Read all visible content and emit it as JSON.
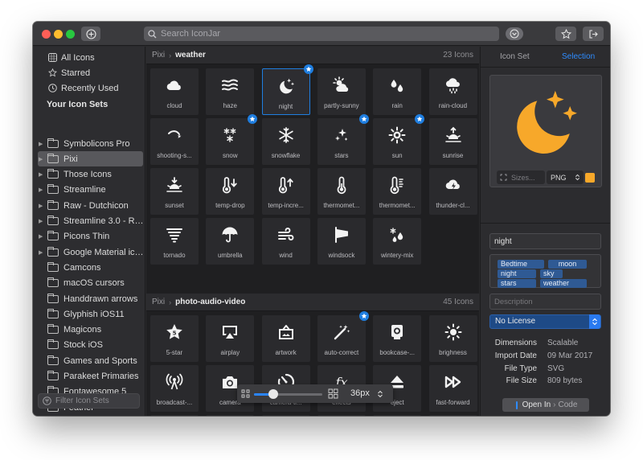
{
  "search": {
    "placeholder": "Search IconJar"
  },
  "sidebar": {
    "library": [
      {
        "label": "All Icons",
        "icon": "grid-icon"
      },
      {
        "label": "Starred",
        "icon": "star-icon"
      },
      {
        "label": "Recently Used",
        "icon": "clock-icon"
      }
    ],
    "sets_heading": "Your Icon Sets",
    "sets": [
      {
        "label": "Symbolicons Pro",
        "expandable": true,
        "selected": false
      },
      {
        "label": "Pixi",
        "expandable": true,
        "selected": true
      },
      {
        "label": "Those Icons",
        "expandable": true,
        "selected": false
      },
      {
        "label": "Streamline",
        "expandable": true,
        "selected": false
      },
      {
        "label": "Raw - Dutchicon",
        "expandable": true,
        "selected": false
      },
      {
        "label": "Streamline 3.0 - Re...",
        "expandable": true,
        "selected": false
      },
      {
        "label": "Picons Thin",
        "expandable": true,
        "selected": false
      },
      {
        "label": "Google Material ico...",
        "expandable": true,
        "selected": false
      },
      {
        "label": "Camcons",
        "expandable": false,
        "selected": false
      },
      {
        "label": "macOS cursors",
        "expandable": false,
        "selected": false
      },
      {
        "label": "Handdrawn arrows",
        "expandable": false,
        "selected": false
      },
      {
        "label": "Glyphish iOS11",
        "expandable": false,
        "selected": false
      },
      {
        "label": "Magicons",
        "expandable": false,
        "selected": false
      },
      {
        "label": "Stock iOS",
        "expandable": false,
        "selected": false
      },
      {
        "label": "Games and Sports",
        "expandable": false,
        "selected": false
      },
      {
        "label": "Parakeet Primaries",
        "expandable": false,
        "selected": false
      },
      {
        "label": "Fontawesome 5",
        "expandable": false,
        "selected": false
      },
      {
        "label": "Feather",
        "expandable": false,
        "selected": false
      }
    ],
    "filter_placeholder": "Filter Icon Sets"
  },
  "sections": [
    {
      "set": "Pixi",
      "group": "weather",
      "count": "23 Icons",
      "icons": [
        {
          "label": "cloud",
          "icon": "cloud-icon",
          "starred": false,
          "selected": false
        },
        {
          "label": "haze",
          "icon": "haze-icon",
          "starred": false,
          "selected": false
        },
        {
          "label": "night",
          "icon": "night-icon",
          "starred": true,
          "selected": true
        },
        {
          "label": "partly-sunny",
          "icon": "partly-sunny-icon",
          "starred": false,
          "selected": false
        },
        {
          "label": "rain",
          "icon": "rain-icon",
          "starred": false,
          "selected": false
        },
        {
          "label": "rain-cloud",
          "icon": "rain-cloud-icon",
          "starred": false,
          "selected": false
        },
        {
          "label": "shooting-s...",
          "icon": "shooting-star-icon",
          "starred": false,
          "selected": false
        },
        {
          "label": "snow",
          "icon": "snow-icon",
          "starred": true,
          "selected": false
        },
        {
          "label": "snowflake",
          "icon": "snowflake-icon",
          "starred": false,
          "selected": false
        },
        {
          "label": "stars",
          "icon": "stars-icon",
          "starred": true,
          "selected": false
        },
        {
          "label": "sun",
          "icon": "sun-icon",
          "starred": true,
          "selected": false
        },
        {
          "label": "sunrise",
          "icon": "sunrise-icon",
          "starred": false,
          "selected": false
        },
        {
          "label": "sunset",
          "icon": "sunset-icon",
          "starred": false,
          "selected": false
        },
        {
          "label": "temp-drop",
          "icon": "temp-drop-icon",
          "starred": false,
          "selected": false
        },
        {
          "label": "temp-incre...",
          "icon": "temp-increase-icon",
          "starred": false,
          "selected": false
        },
        {
          "label": "thermomet...",
          "icon": "thermometer-icon",
          "starred": false,
          "selected": false
        },
        {
          "label": "thermomet...",
          "icon": "thermometer-scale-icon",
          "starred": false,
          "selected": false
        },
        {
          "label": "thunder-cl...",
          "icon": "thunder-cloud-icon",
          "starred": false,
          "selected": false
        },
        {
          "label": "tornado",
          "icon": "tornado-icon",
          "starred": false,
          "selected": false
        },
        {
          "label": "umbrella",
          "icon": "umbrella-icon",
          "starred": false,
          "selected": false
        },
        {
          "label": "wind",
          "icon": "wind-icon",
          "starred": false,
          "selected": false
        },
        {
          "label": "windsock",
          "icon": "windsock-icon",
          "starred": false,
          "selected": false
        },
        {
          "label": "wintery-mix",
          "icon": "wintery-mix-icon",
          "starred": false,
          "selected": false
        }
      ]
    },
    {
      "set": "Pixi",
      "group": "photo-audio-video",
      "count": "45 Icons",
      "icons": [
        {
          "label": "5-star",
          "icon": "five-star-icon",
          "starred": false,
          "selected": false
        },
        {
          "label": "airplay",
          "icon": "airplay-icon",
          "starred": false,
          "selected": false
        },
        {
          "label": "artwork",
          "icon": "artwork-icon",
          "starred": false,
          "selected": false
        },
        {
          "label": "auto-correct",
          "icon": "auto-correct-icon",
          "starred": true,
          "selected": false
        },
        {
          "label": "bookcase-...",
          "icon": "bookcase-icon",
          "starred": false,
          "selected": false
        },
        {
          "label": "brighness",
          "icon": "brightness-icon",
          "starred": false,
          "selected": false
        },
        {
          "label": "broadcast-...",
          "icon": "broadcast-icon",
          "starred": false,
          "selected": false
        },
        {
          "label": "camera",
          "icon": "camera-icon",
          "starred": false,
          "selected": false
        },
        {
          "label": "camera-ti...",
          "icon": "camera-timer-icon",
          "starred": false,
          "selected": false
        },
        {
          "label": "effects",
          "icon": "effects-icon",
          "starred": false,
          "selected": false
        },
        {
          "label": "eject",
          "icon": "eject-icon",
          "starred": false,
          "selected": false
        },
        {
          "label": "fast-forward",
          "icon": "fast-forward-icon",
          "starred": false,
          "selected": false
        },
        {
          "label": "",
          "icon": "film-icon",
          "starred": false,
          "selected": false
        },
        {
          "label": "",
          "icon": "film-strip-icon",
          "starred": false,
          "selected": false
        },
        {
          "label": "",
          "icon": "webcam-icon",
          "starred": false,
          "selected": false
        },
        {
          "label": "",
          "icon": "film-frame-icon",
          "starred": false,
          "selected": false
        },
        {
          "label": "",
          "icon": "headphones-icon",
          "starred": false,
          "selected": false
        },
        {
          "label": "",
          "icon": "image-icon",
          "starred": false,
          "selected": false
        }
      ]
    }
  ],
  "size_control": {
    "value": "36px",
    "slider_fraction": 0.28
  },
  "inspector": {
    "tabs": [
      {
        "label": "Icon Set",
        "active": false
      },
      {
        "label": "Selection",
        "active": true
      }
    ],
    "preview_icon": "night-icon",
    "preview_color": "#f7a82a",
    "sizes_placeholder": "Sizes...",
    "format": "PNG",
    "name": "night",
    "tags": [
      "Bedtime",
      "moon",
      "night",
      "sky",
      "stars",
      "weather"
    ],
    "description_placeholder": "Description",
    "license": "No License",
    "meta": [
      {
        "key": "Dimensions",
        "value": "Scalable"
      },
      {
        "key": "Import Date",
        "value": "09 Mar 2017"
      },
      {
        "key": "File Type",
        "value": "SVG"
      },
      {
        "key": "File Size",
        "value": "809 bytes"
      }
    ],
    "open_label": "Open In",
    "open_target": "Code"
  },
  "colors": {
    "accent": "#1f7ee0",
    "preview": "#f7a82a",
    "license": "#1e4a86"
  }
}
